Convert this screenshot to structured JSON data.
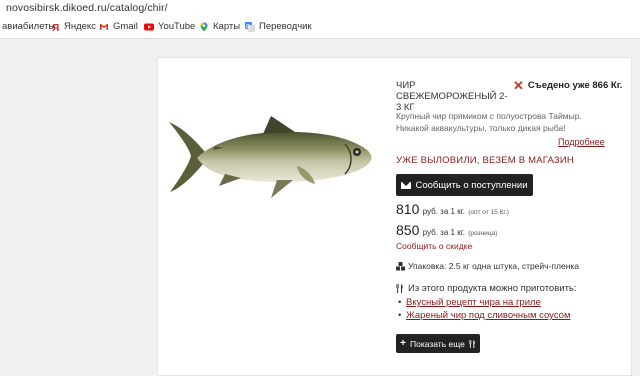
{
  "browser": {
    "url": "novosibirsk.dikoed.ru/catalog/chir/",
    "bookmarks": [
      {
        "label": "авиабилеты",
        "icon": "none"
      },
      {
        "label": "Яндекс",
        "icon": "yandex-icon"
      },
      {
        "label": "Gmail",
        "icon": "gmail-icon"
      },
      {
        "label": "YouTube",
        "icon": "youtube-icon"
      },
      {
        "label": "Карты",
        "icon": "maps-icon"
      },
      {
        "label": "Переводчик",
        "icon": "translate-icon"
      }
    ]
  },
  "product": {
    "title": "ЧИР СВЕЖЕМОРОЖЕНЫЙ 2-3 КГ",
    "eaten_label": "Съедено уже 866 Кг.",
    "description": "Крупный чир прямиком с полуострова Таймыр. Никакой аквакультуры, только дикая рыба!",
    "more_link": "Подробнее",
    "status": "УЖЕ ВЫЛОВИЛИ, ВЕЗЕМ В МАГАЗИН",
    "notify_button": "Сообщить о поступлении",
    "price_wholesale": {
      "value": "810",
      "unit": "руб. за 1 кг.",
      "note": "(опт от 15 Кг.)"
    },
    "price_retail": {
      "value": "850",
      "unit": "руб. за 1 кг.",
      "note": "(розница)"
    },
    "discount_link": "Сообщить о скидке",
    "packaging": "Упаковка: 2.5 кг одна штука, стрейч-пленка",
    "cook_heading": "Из этого продукта можно приготовить:",
    "recipes": [
      "Вкусный рецепт чира на гриле",
      "Жареный чир под сливочным соусом"
    ],
    "show_more_button": "Показать еще"
  },
  "colors": {
    "accent_link": "#8b1a1a",
    "button_bg": "#222222",
    "eaten_x": "#c0392b"
  }
}
